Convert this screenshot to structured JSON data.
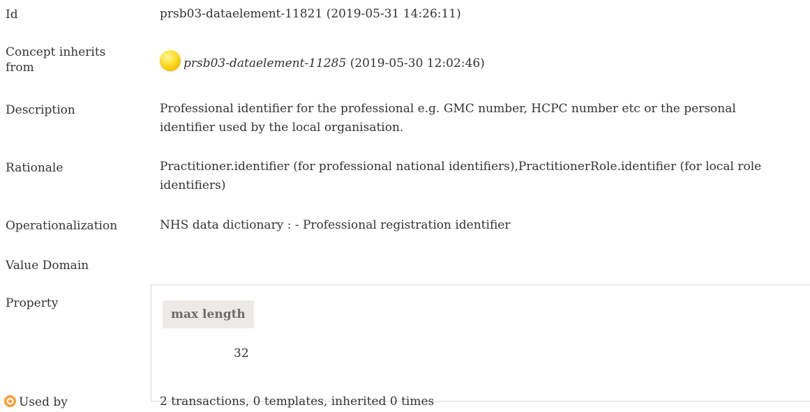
{
  "rows": {
    "id": {
      "label": "Id",
      "value": "prsb03-dataelement-11821 (2019-05-31 14:26:11)"
    },
    "concept_inherits": {
      "label": "Concept inherits from",
      "link": "prsb03-dataelement-11285",
      "suffix": " (2019-05-30 12:02:46)"
    },
    "description": {
      "label": "Description",
      "value": "Professional identifier for the professional e.g. GMC number, HCPC number etc or the personal identifier used by the local organisation."
    },
    "rationale": {
      "label": "Rationale",
      "value": "Practitioner.identifier (for professional national identifiers),PractitionerRole.identifier (for local role identifiers)"
    },
    "operationalization": {
      "label": "Operationalization",
      "value": "NHS data dictionary : - Professional registration identifier"
    },
    "value_domain": {
      "label": "Value Domain"
    },
    "property": {
      "label": "Property",
      "header": "max length",
      "value": "32"
    },
    "used_by": {
      "label": "Used by",
      "value": "2 transactions, 0 templates, inherited 0 times"
    }
  },
  "icons": {
    "concept": "yellow-concept-ball-icon",
    "used_by": "target-icon"
  },
  "colors": {
    "text": "#333333",
    "header_bg": "#ece9e6",
    "concept_yellow": "#ffd21f",
    "target_orange": "#ff9b2f"
  }
}
